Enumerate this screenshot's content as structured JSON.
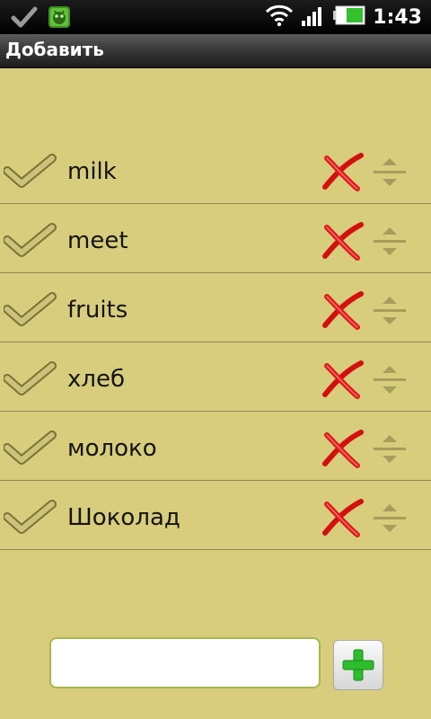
{
  "status_bar": {
    "time": "1:43",
    "left_icons": [
      "check-icon",
      "android-notification-icon"
    ],
    "right_icons": [
      "wifi-icon",
      "signal-icon",
      "battery-icon"
    ]
  },
  "header": {
    "title": "Добавить"
  },
  "list": {
    "items": [
      {
        "label": "milk"
      },
      {
        "label": "meet"
      },
      {
        "label": "fruits"
      },
      {
        "label": "хлеб"
      },
      {
        "label": "молоко"
      },
      {
        "label": "Шоколад"
      }
    ],
    "row_icons": [
      "checkmark-icon",
      "delete-icon",
      "drag-handle-icon"
    ]
  },
  "add_form": {
    "input_value": "",
    "add_button_icon": "plus-icon"
  },
  "colors": {
    "background": "#d8cd7c",
    "row_divider": "#8e8755",
    "delete_red": "#d21010",
    "add_green": "#2dbe2d"
  }
}
